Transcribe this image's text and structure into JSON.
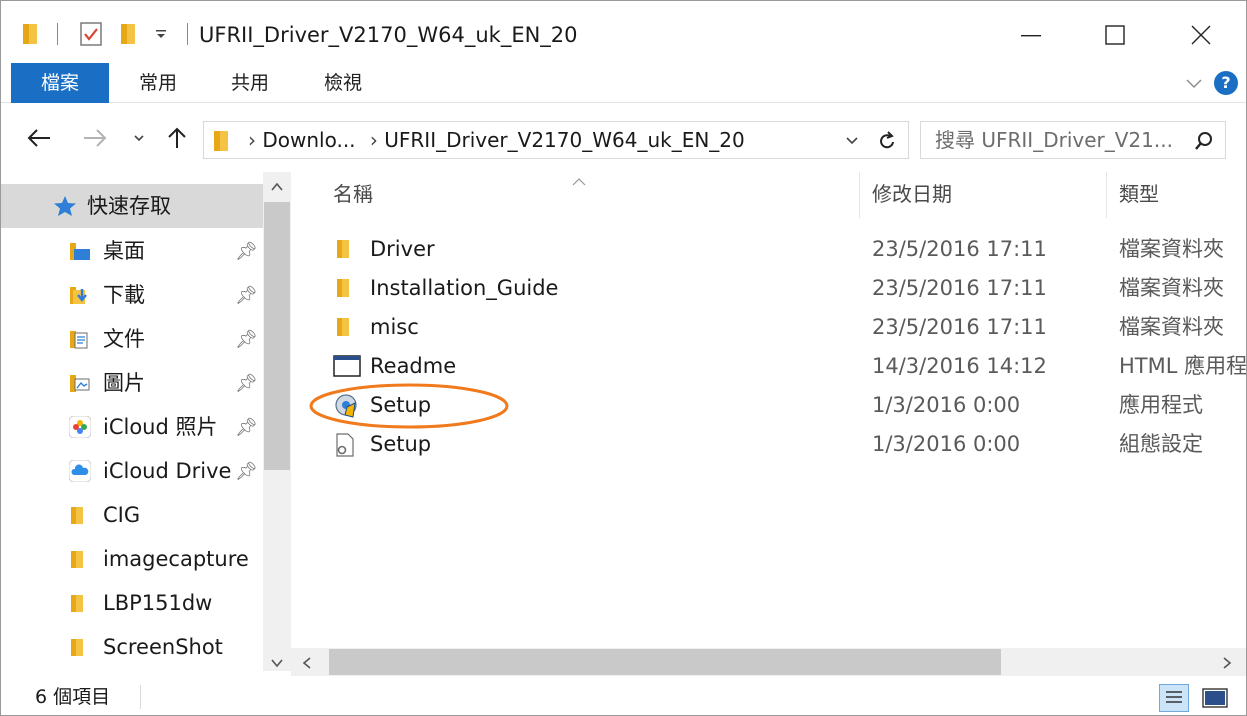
{
  "window": {
    "title": "UFRII_Driver_V2170_W64_uk_EN_20"
  },
  "ribbon": {
    "tabs": [
      "檔案",
      "常用",
      "共用",
      "檢視"
    ],
    "help_label": "?"
  },
  "nav": {
    "breadcrumb": [
      "Downlo...",
      "UFRII_Driver_V2170_W64_uk_EN_20"
    ],
    "search_placeholder": "搜尋 UFRII_Driver_V21..."
  },
  "sidebar": {
    "quick_access_label": "快速存取",
    "items": [
      {
        "label": "桌面",
        "icon": "desktop-folder-icon",
        "pinned": true
      },
      {
        "label": "下載",
        "icon": "downloads-folder-icon",
        "pinned": true
      },
      {
        "label": "文件",
        "icon": "documents-folder-icon",
        "pinned": true
      },
      {
        "label": "圖片",
        "icon": "pictures-folder-icon",
        "pinned": true
      },
      {
        "label": "iCloud 照片",
        "icon": "icloud-photos-icon",
        "pinned": true
      },
      {
        "label": "iCloud Drive",
        "icon": "icloud-drive-icon",
        "pinned": true
      },
      {
        "label": "CIG",
        "icon": "folder-icon",
        "pinned": false
      },
      {
        "label": "imagecapture",
        "icon": "folder-icon",
        "pinned": false
      },
      {
        "label": "LBP151dw",
        "icon": "folder-icon",
        "pinned": false
      },
      {
        "label": "ScreenShot",
        "icon": "folder-icon",
        "pinned": false
      }
    ]
  },
  "columns": {
    "name": "名稱",
    "date": "修改日期",
    "type": "類型"
  },
  "files": [
    {
      "name": "Driver",
      "date": "23/5/2016 17:11",
      "type": "檔案資料夾",
      "icon": "folder-icon"
    },
    {
      "name": "Installation_Guide",
      "date": "23/5/2016 17:11",
      "type": "檔案資料夾",
      "icon": "folder-icon"
    },
    {
      "name": "misc",
      "date": "23/5/2016 17:11",
      "type": "檔案資料夾",
      "icon": "folder-icon"
    },
    {
      "name": "Readme",
      "date": "14/3/2016 14:12",
      "type": "HTML 應用程",
      "icon": "html-app-icon"
    },
    {
      "name": "Setup",
      "date": "1/3/2016 0:00",
      "type": "應用程式",
      "icon": "setup-exe-icon",
      "highlighted": true
    },
    {
      "name": "Setup",
      "date": "1/3/2016 0:00",
      "type": "組態設定",
      "icon": "config-file-icon"
    }
  ],
  "status": {
    "item_count": "6 個項目"
  },
  "colors": {
    "accent": "#1a6fc4",
    "highlight_ellipse": "#f07a1c",
    "folder_yellow": "#f5c343"
  }
}
